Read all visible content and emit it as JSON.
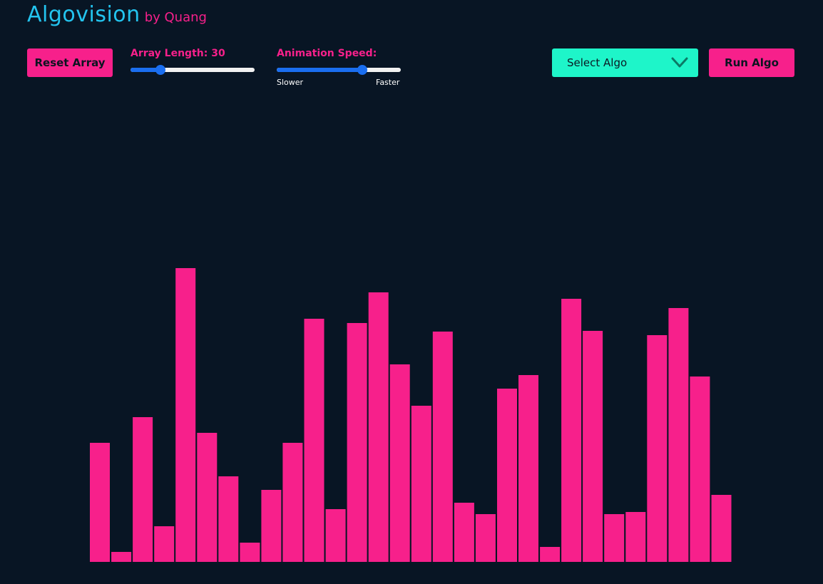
{
  "header": {
    "title": "Algovision",
    "byline": "by Quang"
  },
  "controls": {
    "reset_label": "Reset Array",
    "array_length_label": "Array Length: 30",
    "array_length_value": 30,
    "array_length_fraction": 0.24,
    "speed_label": "Animation Speed:",
    "speed_fraction": 0.69,
    "slower_label": "Slower",
    "faster_label": "Faster",
    "select_label": "Select Algo",
    "run_label": "Run Algo"
  },
  "colors": {
    "background": "#081524",
    "title": "#23c4ef",
    "accent": "#f7208b",
    "select": "#1ef5c9",
    "slider": "#1a6ef0"
  },
  "chart_data": {
    "type": "bar",
    "values": [
      167,
      14,
      203,
      50,
      412,
      181,
      120,
      27,
      101,
      167,
      341,
      74,
      335,
      378,
      277,
      219,
      323,
      83,
      67,
      243,
      262,
      21,
      369,
      324,
      67,
      70,
      318,
      356,
      260,
      94
    ]
  }
}
